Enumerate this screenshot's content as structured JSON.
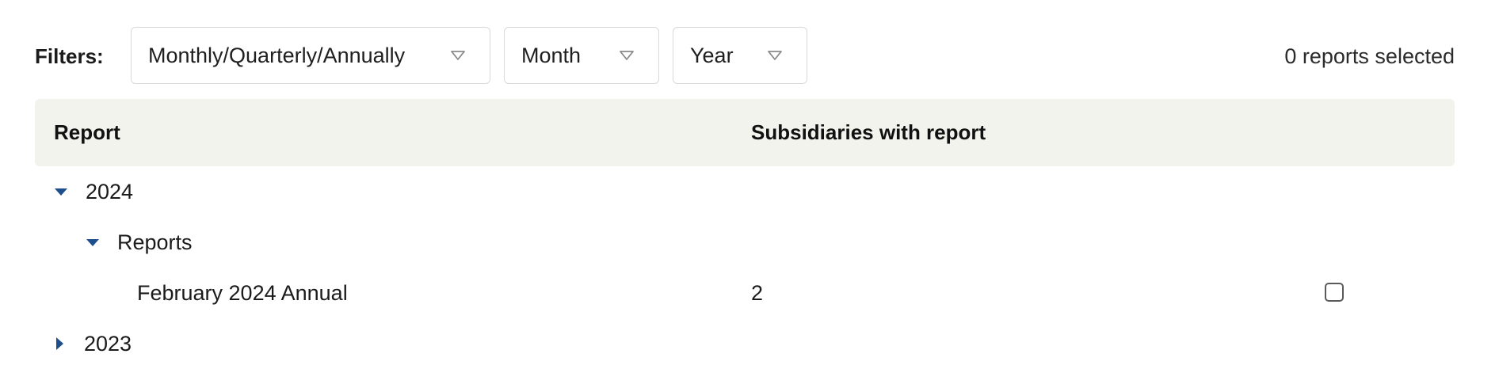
{
  "filters": {
    "label": "Filters:",
    "frequency": {
      "selected": "Monthly/Quarterly/Annually",
      "icon": "chevron-down-outline-icon"
    },
    "month": {
      "selected": "Month",
      "icon": "chevron-down-outline-icon"
    },
    "year": {
      "selected": "Year",
      "icon": "chevron-down-outline-icon"
    },
    "selected_count": "0 reports selected"
  },
  "table": {
    "columns": [
      "Report",
      "Subsidiaries with report"
    ],
    "tree": [
      {
        "label": "2024",
        "expanded": true
      },
      {
        "label": "Reports",
        "expanded": true
      },
      {
        "label": "February 2024 Annual",
        "subsidiaries": "2",
        "checked": false
      },
      {
        "label": "2023",
        "expanded": false
      }
    ]
  },
  "colors": {
    "accent": "#1f4e8c",
    "header_bg": "#f3f3ee",
    "border": "#d9d9d9"
  }
}
